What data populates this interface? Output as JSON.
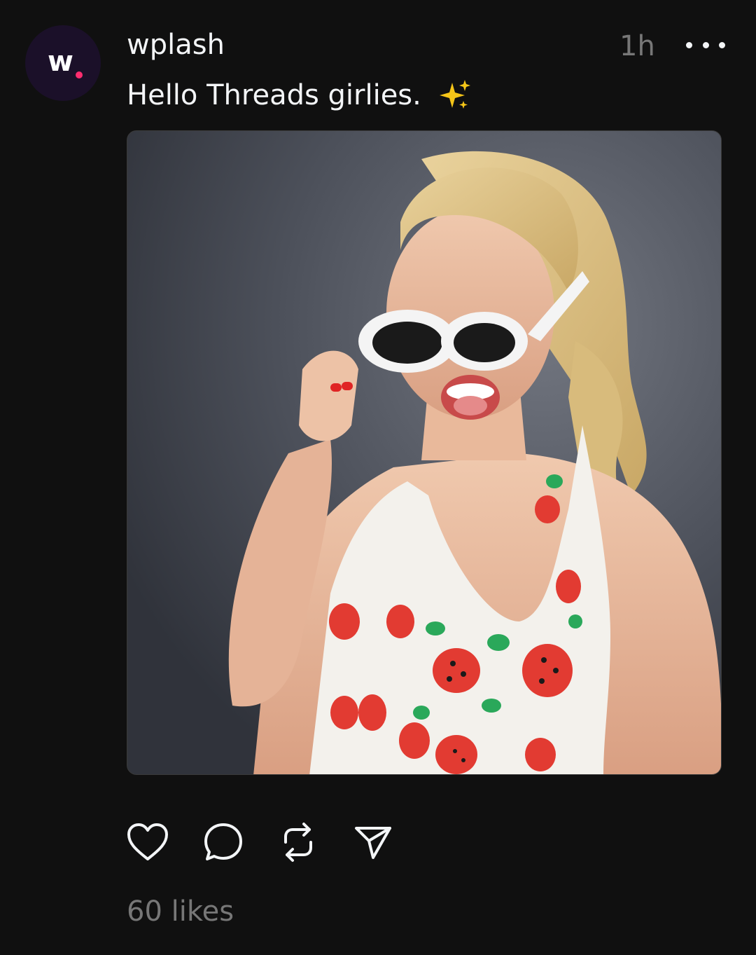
{
  "post": {
    "author": {
      "username": "wplash",
      "avatar_text": "w",
      "avatar_accent": "#ff2d6f"
    },
    "time_ago": "1h",
    "caption": "Hello Threads girlies.",
    "caption_emoji_icon": "sparkles-icon",
    "image_icon": "photo-image",
    "likes_text": "60 likes"
  },
  "actions": [
    {
      "icon": "heart-icon"
    },
    {
      "icon": "comment-icon"
    },
    {
      "icon": "repost-icon"
    },
    {
      "icon": "share-icon"
    }
  ],
  "colors": {
    "background": "#101010",
    "primary_text": "#f3f5f7",
    "secondary_text": "#777777",
    "avatar_bg": "#1b1029"
  }
}
